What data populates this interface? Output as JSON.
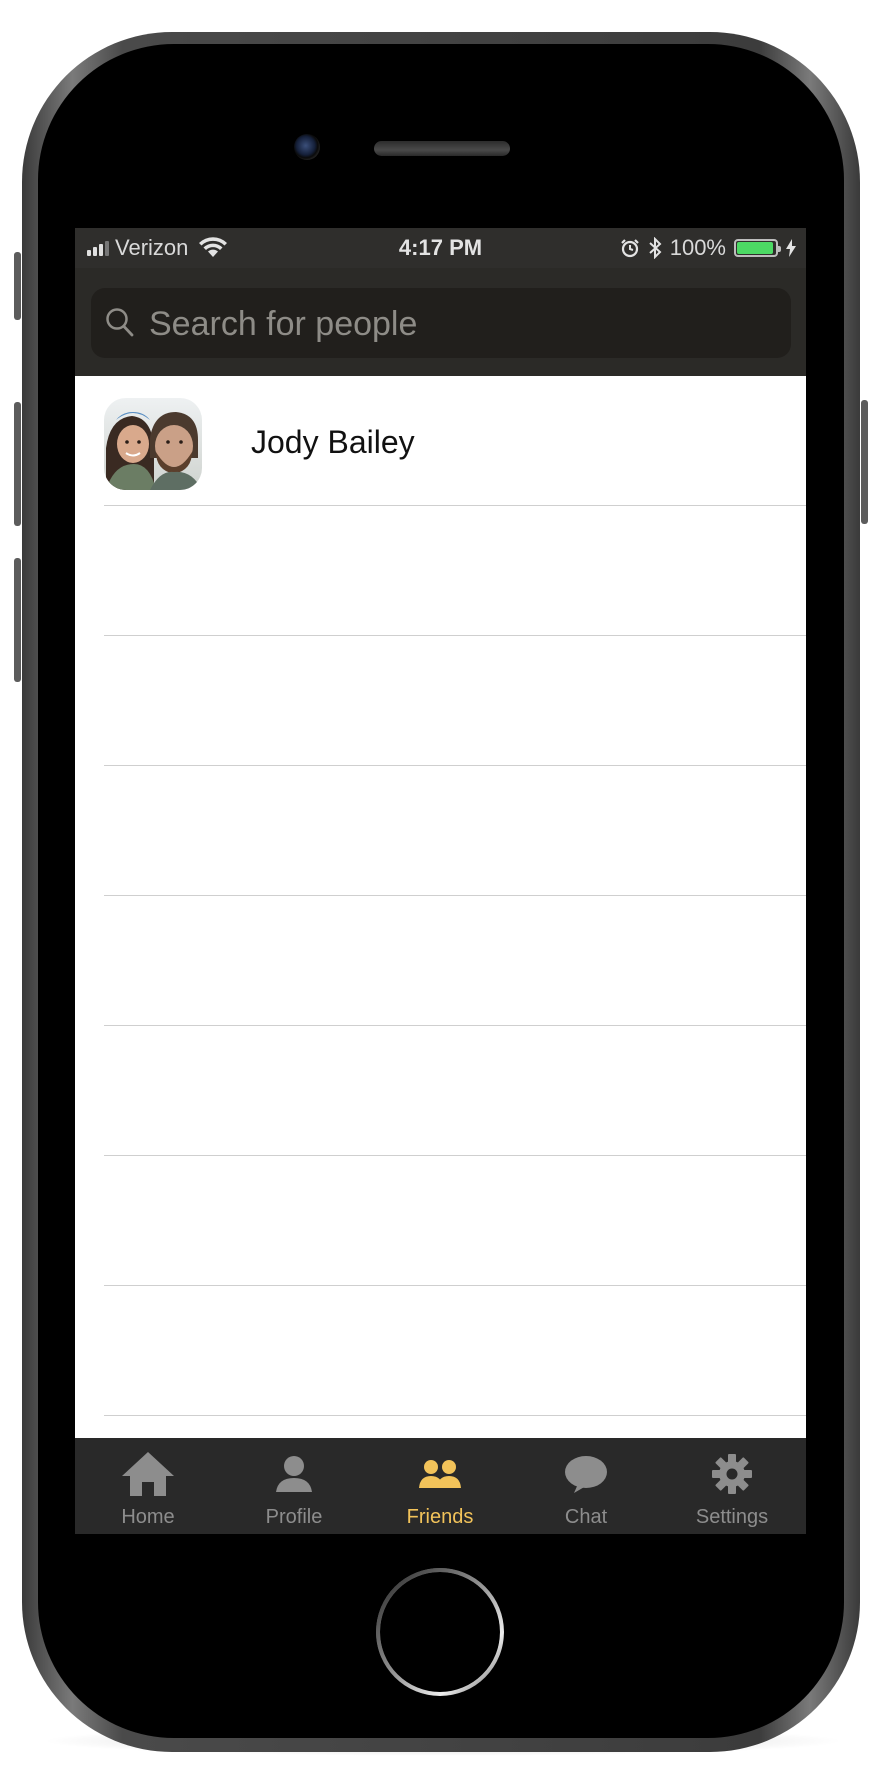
{
  "status_bar": {
    "carrier": "Verizon",
    "time": "4:17 PM",
    "battery_percent": "100%",
    "battery_level": 1.0
  },
  "search": {
    "placeholder": "Search for people"
  },
  "friends": [
    {
      "name": "Jody Bailey"
    }
  ],
  "tabs": [
    {
      "label": "Home",
      "icon": "home-icon",
      "active": false
    },
    {
      "label": "Profile",
      "icon": "profile-icon",
      "active": false
    },
    {
      "label": "Friends",
      "icon": "friends-icon",
      "active": true
    },
    {
      "label": "Chat",
      "icon": "chat-icon",
      "active": false
    },
    {
      "label": "Settings",
      "icon": "gear-icon",
      "active": false
    }
  ],
  "colors": {
    "accent": "#f2c35a",
    "bar_background": "#2b2a27",
    "tab_inactive": "#8d8d8d",
    "battery": "#4cd964"
  }
}
